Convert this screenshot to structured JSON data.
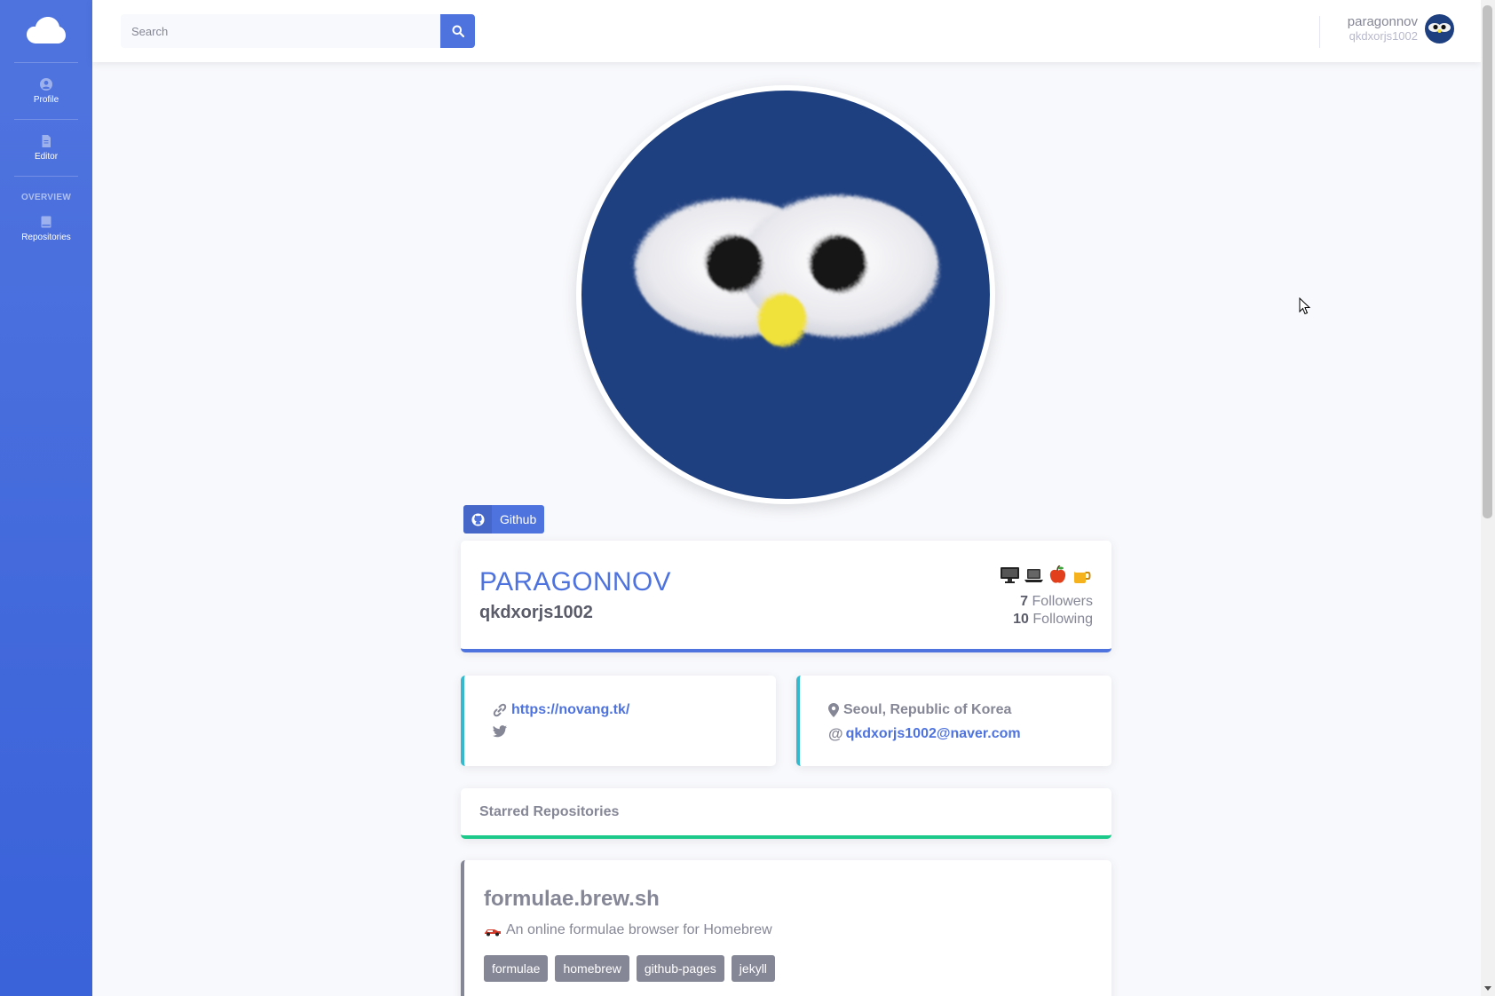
{
  "sidebar": {
    "brand_icon": "cloud-icon",
    "items": [
      {
        "label": "Profile",
        "icon": "user-circle-icon"
      },
      {
        "label": "Editor",
        "icon": "file-icon"
      }
    ],
    "heading": "OVERVIEW",
    "items2": [
      {
        "label": "Repositories",
        "icon": "book-icon"
      }
    ],
    "colors": {
      "primary": "#4e73df"
    }
  },
  "topbar": {
    "search": {
      "placeholder": "Search",
      "value": "",
      "button_icon": "search-icon"
    },
    "user": {
      "display_name": "paragonnov",
      "login": "qkdxorjs1002"
    }
  },
  "profile": {
    "github_label": "Github",
    "name": "PARAGONNOV",
    "login": "qkdxorjs1002",
    "followers_count": "7",
    "followers_label": "Followers",
    "following_count": "10",
    "following_label": "Following",
    "website": "https://novang.tk/",
    "location": "Seoul, Republic of Korea",
    "email": "qkdxorjs1002@naver.com"
  },
  "starred": {
    "title": "Starred Repositories",
    "repos": [
      {
        "name": "formulae.brew.sh",
        "description": "An online formulae browser for Homebrew",
        "tags": [
          "formulae",
          "homebrew",
          "github-pages",
          "jekyll"
        ]
      }
    ]
  }
}
